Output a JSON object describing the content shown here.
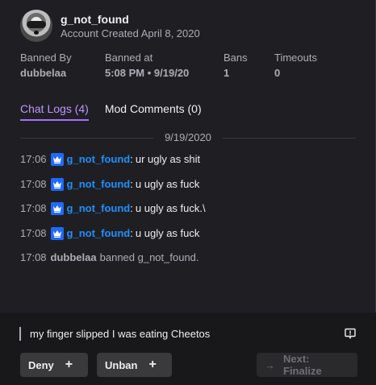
{
  "user": {
    "name": "g_not_found",
    "created": "Account Created April 8, 2020"
  },
  "stats": [
    {
      "label": "Banned By",
      "value": "dubbelaa"
    },
    {
      "label": "Banned at",
      "value": "5:08 PM • 9/19/20"
    },
    {
      "label": "Bans",
      "value": "1"
    },
    {
      "label": "Timeouts",
      "value": "0"
    }
  ],
  "tabs": [
    {
      "label": "Chat Logs (4)",
      "active": true
    },
    {
      "label": "Mod Comments (0)",
      "active": false
    }
  ],
  "date": "9/19/2020",
  "messages": [
    {
      "time": "17:06",
      "user": "g_not_found",
      "text": "ur ugly as shit"
    },
    {
      "time": "17:08",
      "user": "g_not_found",
      "text": "u ugly as fuck"
    },
    {
      "time": "17:08",
      "user": "g_not_found",
      "text": "u ugly as fuck.\\"
    },
    {
      "time": "17:08",
      "user": "g_not_found",
      "text": "u ugly as fuck"
    }
  ],
  "system_message": {
    "time": "17:08",
    "user": "dubbelaa",
    "text": "banned g_not_found."
  },
  "note": "my finger slipped I was eating Cheetos",
  "buttons": {
    "deny": "Deny",
    "unban": "Unban",
    "next": "Next: Finalize",
    "plus": "+",
    "arrow": "→"
  },
  "colors": {
    "accent": "#a970ff",
    "badge": "#1e69ff",
    "username": "#1e90ff"
  }
}
